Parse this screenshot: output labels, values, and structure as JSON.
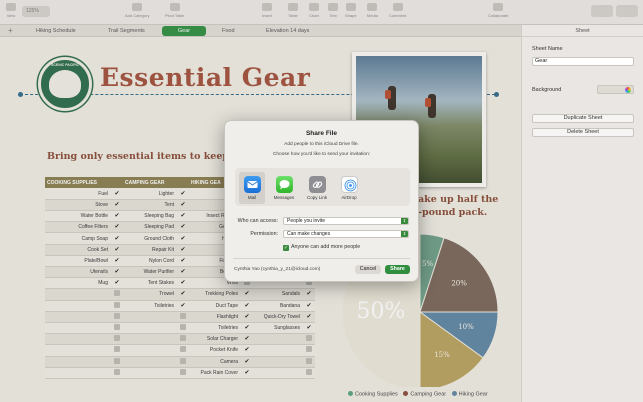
{
  "toolbar": {
    "zoom": "125%",
    "items": [
      "View",
      "Zoom",
      "Add Category",
      "Pivot Table",
      "Insert",
      "Table",
      "Chart",
      "Text",
      "Shape",
      "Media",
      "Comment",
      "Collaborate",
      "Format",
      "Organize"
    ]
  },
  "tabs": [
    "Hiking Schedule",
    "Trail Segments",
    "Gear",
    "Food",
    "Elevation 14 days"
  ],
  "active_tab": "Gear",
  "badge": {
    "top": "SCENIC PACIFIC",
    "bottom": "TRAILS"
  },
  "title": "Essential Gear",
  "subtitle": "Bring only essential items to keep you",
  "subtitle2_line1": "ake up half the",
  "subtitle2_line2": "-pound pack.",
  "table": {
    "headers": [
      "COOKING SUPPLIES",
      "",
      "CAMPING GEAR",
      "",
      "HIKING GEA",
      "",
      "",
      ""
    ],
    "rows": [
      [
        "Fuel",
        "y",
        "Lighter",
        "y",
        "Backp",
        "",
        "",
        ""
      ],
      [
        "Stove",
        "y",
        "Tent",
        "y",
        "Boots",
        "",
        "",
        ""
      ],
      [
        "Water Bottle",
        "y",
        "Sleeping Bag",
        "y",
        "Insect Repelle",
        "",
        "",
        ""
      ],
      [
        "Coffee Filters",
        "y",
        "Sleeping Pad",
        "y",
        "Guidebo",
        "",
        "",
        ""
      ],
      [
        "Camp Soap",
        "y",
        "Ground Cloth",
        "y",
        "Headla",
        "",
        "",
        ""
      ],
      [
        "Cook Set",
        "y",
        "Repair Kit",
        "y",
        "Batter",
        "",
        "",
        ""
      ],
      [
        "Plate/Bowl",
        "y",
        "Nylon Cord",
        "y",
        "First-Aid",
        "",
        "",
        ""
      ],
      [
        "Utensils",
        "y",
        "Water Purifier",
        "y",
        "Bear Sp",
        "",
        "",
        ""
      ],
      [
        "Mug",
        "y",
        "Tent Stakes",
        "y",
        "Whis",
        "",
        "",
        ""
      ],
      [
        "",
        "n",
        "Trowel",
        "y",
        "Trekking Poles",
        "y",
        "Sandals",
        "y"
      ],
      [
        "",
        "n",
        "Toiletries",
        "y",
        "Duct Tape",
        "y",
        "Bandana",
        "y"
      ],
      [
        "",
        "n",
        "",
        "n",
        "Flashlight",
        "y",
        "Quick-Dry Towel",
        "y"
      ],
      [
        "",
        "n",
        "",
        "n",
        "Toiletries",
        "y",
        "Sunglasses",
        "y"
      ],
      [
        "",
        "n",
        "",
        "n",
        "Solar Charger",
        "y",
        "",
        "n"
      ],
      [
        "",
        "n",
        "",
        "n",
        "Pocket Knife",
        "y",
        "",
        "n"
      ],
      [
        "",
        "n",
        "",
        "n",
        "Camera",
        "y",
        "",
        "n"
      ],
      [
        "",
        "n",
        "",
        "n",
        "Pack Rain Cover",
        "y",
        "",
        "n"
      ]
    ]
  },
  "chart_data": {
    "type": "pie",
    "slices": [
      {
        "label": "Cooking Supplies",
        "value": 50,
        "display": "50%",
        "color": "#ede8da"
      },
      {
        "label": "Camping Gear",
        "value": 5,
        "display": "5%",
        "color": "#6fa088"
      },
      {
        "label": "Hiking Gear",
        "value": 20,
        "display": "20%",
        "color": "#7a6658"
      },
      {
        "label": "",
        "value": 10,
        "display": "10%",
        "color": "#5f86a3"
      },
      {
        "label": "",
        "value": 15,
        "display": "15%",
        "color": "#b9a25e"
      }
    ],
    "legend": [
      "Cooking Supplies",
      "Camping Gear",
      "Hiking Gear"
    ],
    "legend_colors": [
      "#5aa37a",
      "#8b4a3a",
      "#5f86a3"
    ]
  },
  "sidebar": {
    "header": "Sheet",
    "sheet_name_label": "Sheet Name",
    "sheet_name_value": "Gear",
    "background_label": "Background",
    "duplicate_button": "Duplicate Sheet",
    "delete_button": "Delete Sheet"
  },
  "dialog": {
    "title": "Share File",
    "line1": "Add people to this iCloud Drive file.",
    "line2": "Choose how you'd like to send your invitation:",
    "apps": [
      "Mail",
      "Messages",
      "Copy Link",
      "AirDrop"
    ],
    "selected_app": "Mail",
    "access_label": "Who can access:",
    "access_value": "People you invite",
    "permission_label": "Permission:",
    "permission_value": "Can make changes",
    "checkbox_label": "Anyone can add more people",
    "owner": "Cynthia Yao (cynthia_y_21@icloud.com)",
    "cancel": "Cancel",
    "share": "Share"
  }
}
